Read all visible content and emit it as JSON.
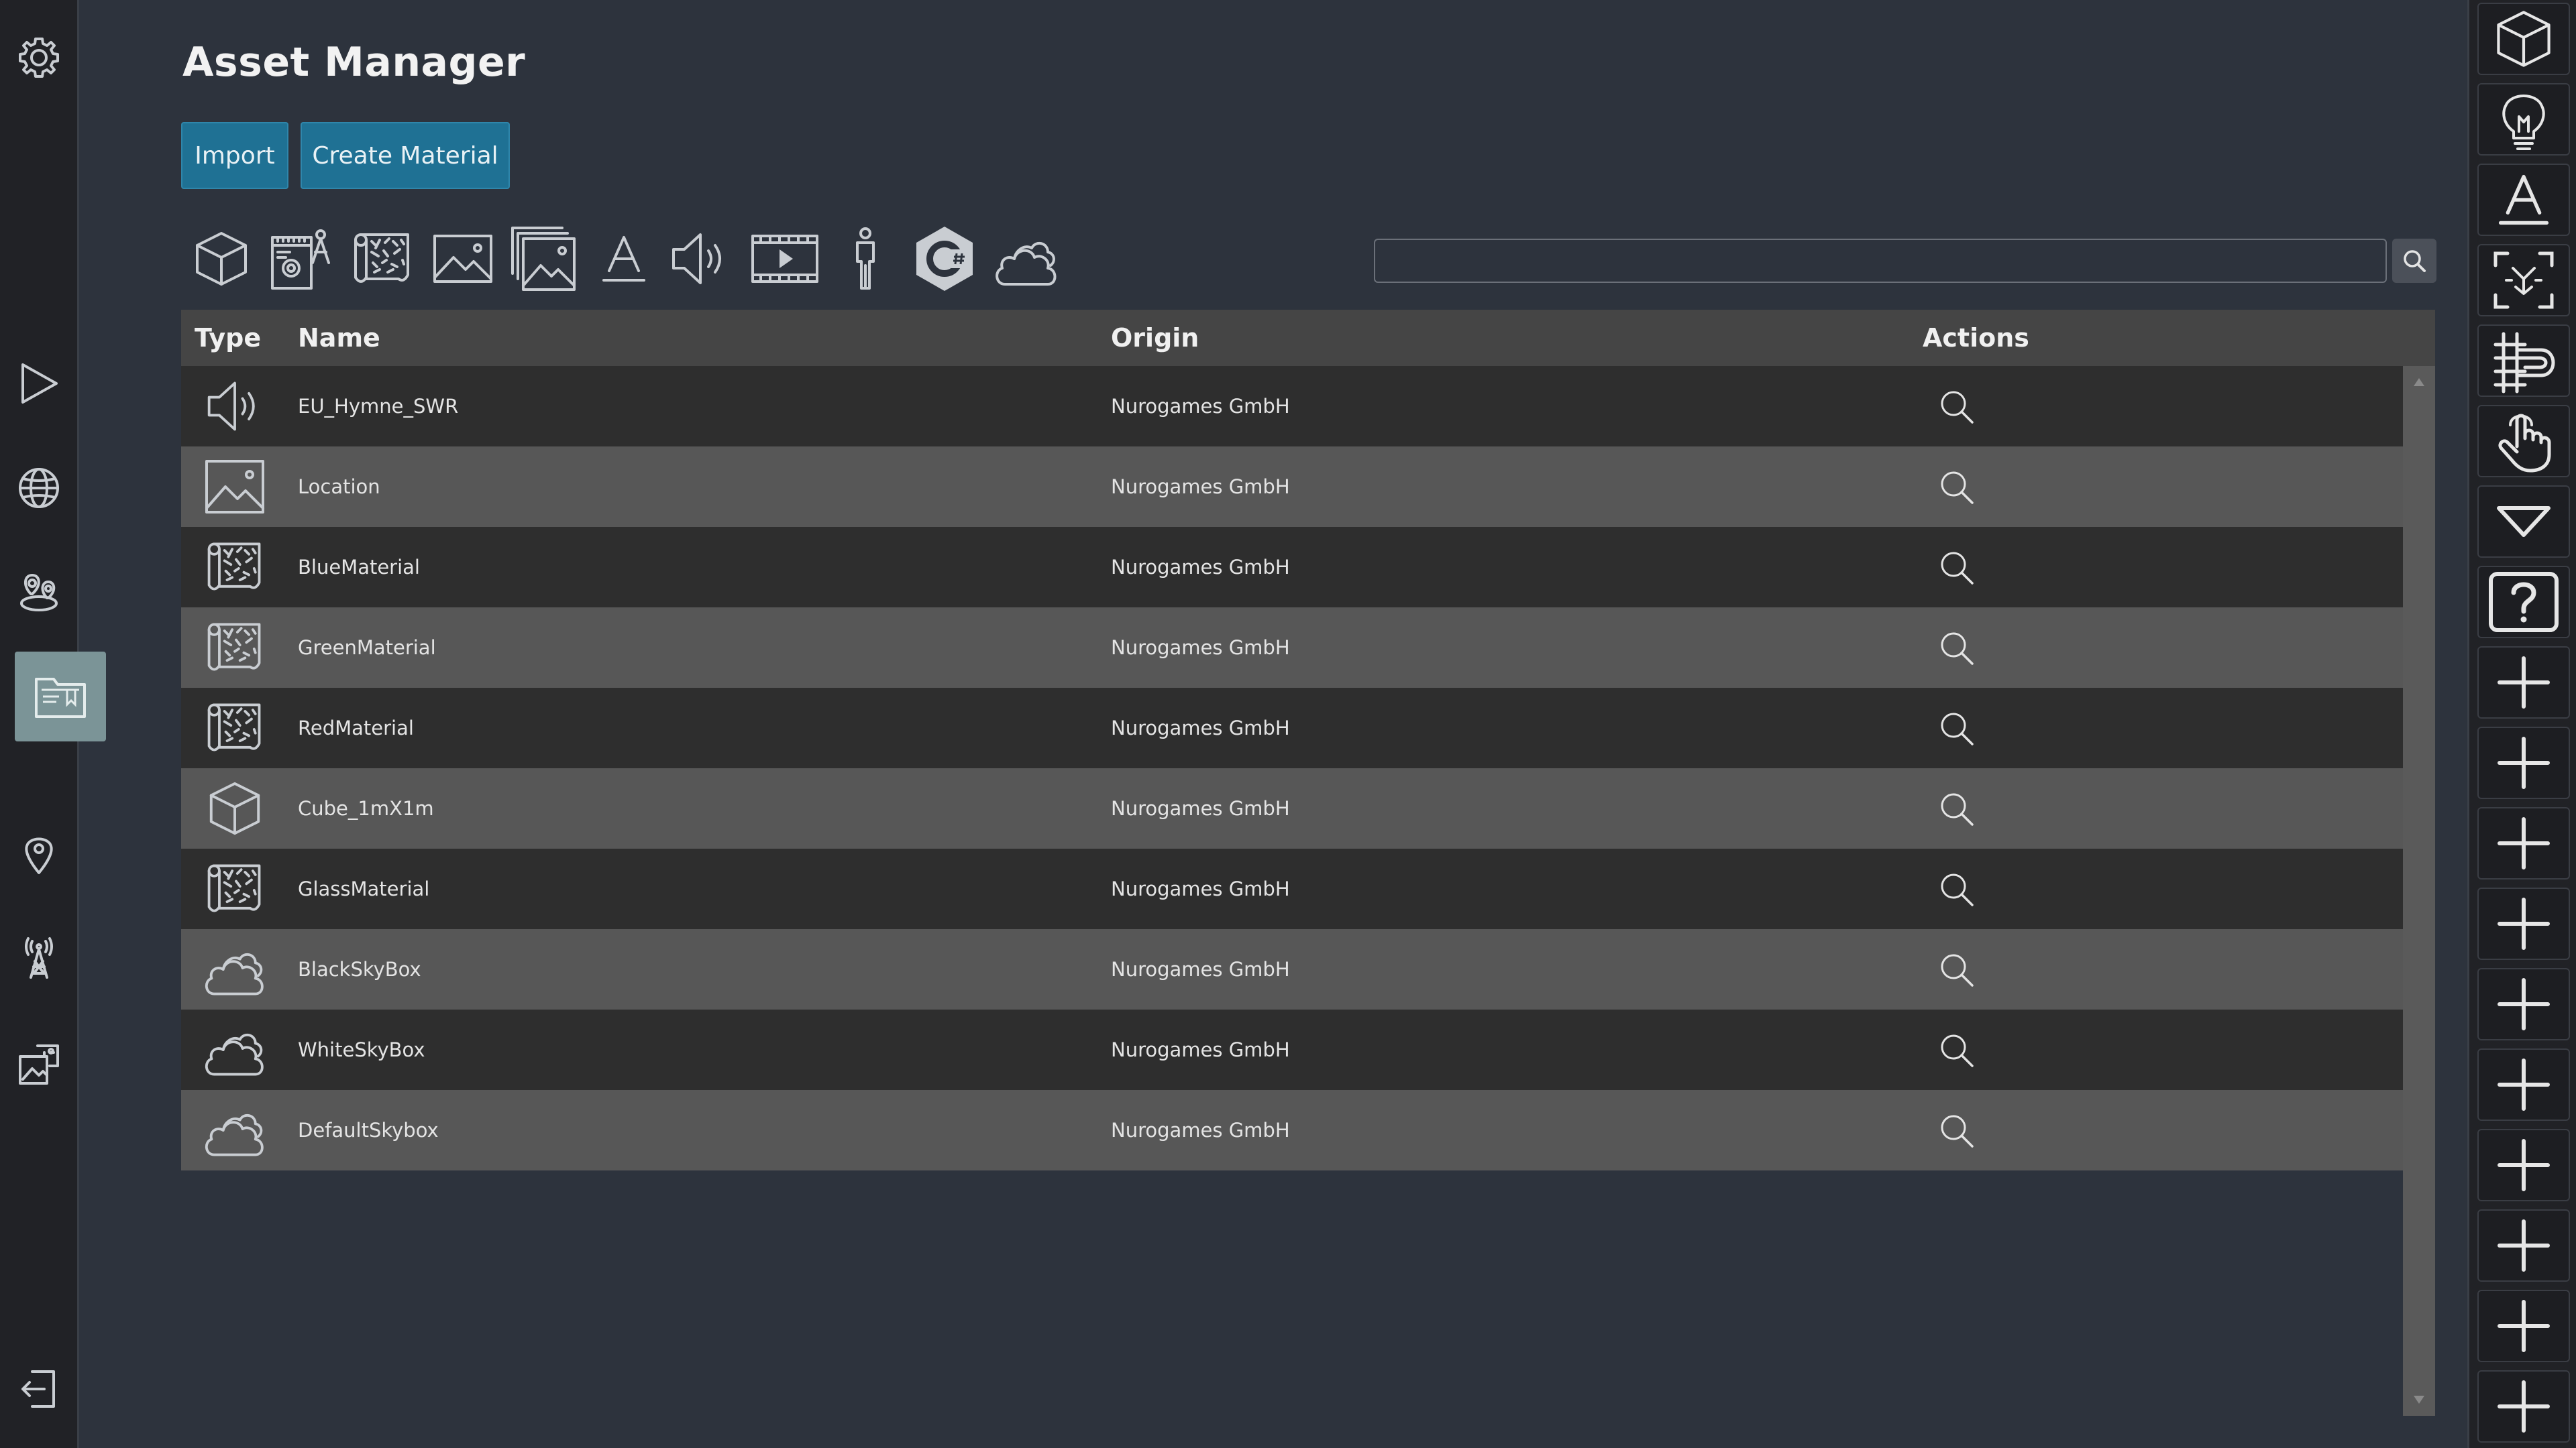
{
  "page": {
    "title": "Asset Manager"
  },
  "buttons": {
    "import": "Import",
    "create_material": "Create Material"
  },
  "left_sidebar": [
    {
      "icon": "gear-icon"
    },
    {
      "icon": "play-icon"
    },
    {
      "icon": "globe-icon"
    },
    {
      "icon": "map-pins-icon"
    },
    {
      "icon": "folder-icon",
      "active": true
    },
    {
      "icon": "location-pin-icon"
    },
    {
      "icon": "antenna-tower-icon"
    },
    {
      "icon": "puzzle-image-icon"
    },
    {
      "icon": "logout-icon"
    }
  ],
  "filters": [
    {
      "icon": "cube-icon"
    },
    {
      "icon": "blueprint-icon"
    },
    {
      "icon": "material-icon"
    },
    {
      "icon": "image-icon"
    },
    {
      "icon": "image-gallery-icon"
    },
    {
      "icon": "font-icon"
    },
    {
      "icon": "audio-icon"
    },
    {
      "icon": "video-icon"
    },
    {
      "icon": "avatar-icon"
    },
    {
      "icon": "csharp-script-icon"
    },
    {
      "icon": "skybox-icon"
    }
  ],
  "search": {
    "value": "",
    "placeholder": ""
  },
  "table": {
    "headers": {
      "type": "Type",
      "name": "Name",
      "origin": "Origin",
      "actions": "Actions"
    },
    "rows": [
      {
        "type": "audio",
        "name": "EU_Hymne_SWR",
        "origin": "Nurogames GmbH"
      },
      {
        "type": "image",
        "name": "Location",
        "origin": "Nurogames GmbH"
      },
      {
        "type": "material",
        "name": "BlueMaterial",
        "origin": "Nurogames GmbH"
      },
      {
        "type": "material",
        "name": "GreenMaterial",
        "origin": "Nurogames GmbH"
      },
      {
        "type": "material",
        "name": "RedMaterial",
        "origin": "Nurogames GmbH"
      },
      {
        "type": "model",
        "name": "Cube_1mX1m",
        "origin": "Nurogames GmbH"
      },
      {
        "type": "material",
        "name": "GlassMaterial",
        "origin": "Nurogames GmbH"
      },
      {
        "type": "skybox",
        "name": "BlackSkyBox",
        "origin": "Nurogames GmbH"
      },
      {
        "type": "skybox",
        "name": "WhiteSkyBox",
        "origin": "Nurogames GmbH"
      },
      {
        "type": "skybox",
        "name": "DefaultSkybox",
        "origin": "Nurogames GmbH"
      }
    ]
  },
  "right_toolbar": [
    {
      "icon": "cube-icon"
    },
    {
      "icon": "lightbulb-icon"
    },
    {
      "icon": "text-icon"
    },
    {
      "icon": "focus-frame-icon"
    },
    {
      "icon": "rail-track-icon"
    },
    {
      "icon": "hand-pointer-icon"
    },
    {
      "icon": "dropdown-triangle-icon"
    },
    {
      "icon": "help-icon"
    },
    {
      "icon": "plus-icon"
    },
    {
      "icon": "plus-icon"
    },
    {
      "icon": "plus-icon"
    },
    {
      "icon": "plus-icon"
    },
    {
      "icon": "plus-icon"
    },
    {
      "icon": "plus-icon"
    },
    {
      "icon": "plus-icon"
    },
    {
      "icon": "plus-icon"
    },
    {
      "icon": "plus-icon"
    },
    {
      "icon": "plus-icon"
    }
  ],
  "colors": {
    "background": "#2d333d",
    "sidebar": "#212226",
    "accent_button": "#1f7194",
    "active_nav": "#7b9497",
    "row_dark": "#2e2e2e",
    "row_light": "#575757",
    "header": "#454545"
  }
}
